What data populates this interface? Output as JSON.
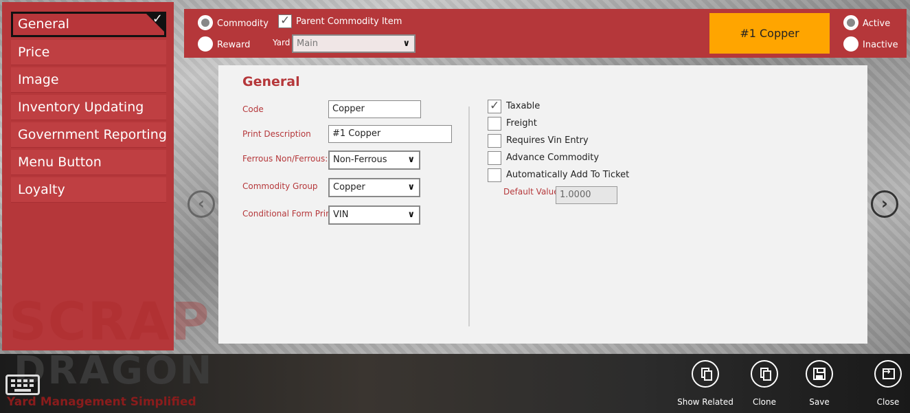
{
  "sidebar": {
    "items": [
      {
        "label": "General",
        "selected": true
      },
      {
        "label": "Price"
      },
      {
        "label": "Image"
      },
      {
        "label": "Inventory Updating"
      },
      {
        "label": "Government Reporting"
      },
      {
        "label": "Menu Button"
      },
      {
        "label": "Loyalty"
      }
    ]
  },
  "topbar": {
    "type_options": [
      {
        "label": "Commodity",
        "checked": true
      },
      {
        "label": "Reward",
        "checked": false
      }
    ],
    "parent_commodity_label": "Parent Commodity Item",
    "parent_commodity_checked": true,
    "yard_label": "Yard",
    "yard_value": "Main",
    "commodity_badge": "#1 Copper",
    "status_options": [
      {
        "label": "Active",
        "checked": true
      },
      {
        "label": "Inactive",
        "checked": false
      }
    ]
  },
  "general": {
    "title": "General",
    "fields": {
      "code_label": "Code",
      "code_value": "Copper",
      "print_description_label": "Print Description",
      "print_description_value": "#1 Copper",
      "ferrous_label": "Ferrous Non/Ferrous:",
      "ferrous_value": "Non-Ferrous",
      "commodity_group_label": "Commodity Group",
      "commodity_group_value": "Copper",
      "conditional_form_label": "Conditional Form Print",
      "conditional_form_value": "VIN"
    },
    "checkboxes": [
      {
        "label": "Taxable",
        "checked": true
      },
      {
        "label": "Freight",
        "checked": false
      },
      {
        "label": "Requires Vin Entry",
        "checked": false
      },
      {
        "label": "Advance Commodity",
        "checked": false
      },
      {
        "label": "Automatically Add To Ticket",
        "checked": false
      }
    ],
    "default_value_label": "Default Value",
    "default_value": "1.0000"
  },
  "branding": {
    "scrap": "SCRAP",
    "dragon": "DRAGON",
    "tagline": "Yard Management Simplified"
  },
  "actions": {
    "show_related": "Show Related",
    "clone": "Clone",
    "save": "Save",
    "close": "Close"
  },
  "colors": {
    "accent": "#b5373a",
    "badge": "#ffa500",
    "panel": "#f2f2f2"
  },
  "icons": {
    "selected_check": "✓",
    "prev": "‹",
    "next": "›",
    "dropdown": "∨"
  }
}
